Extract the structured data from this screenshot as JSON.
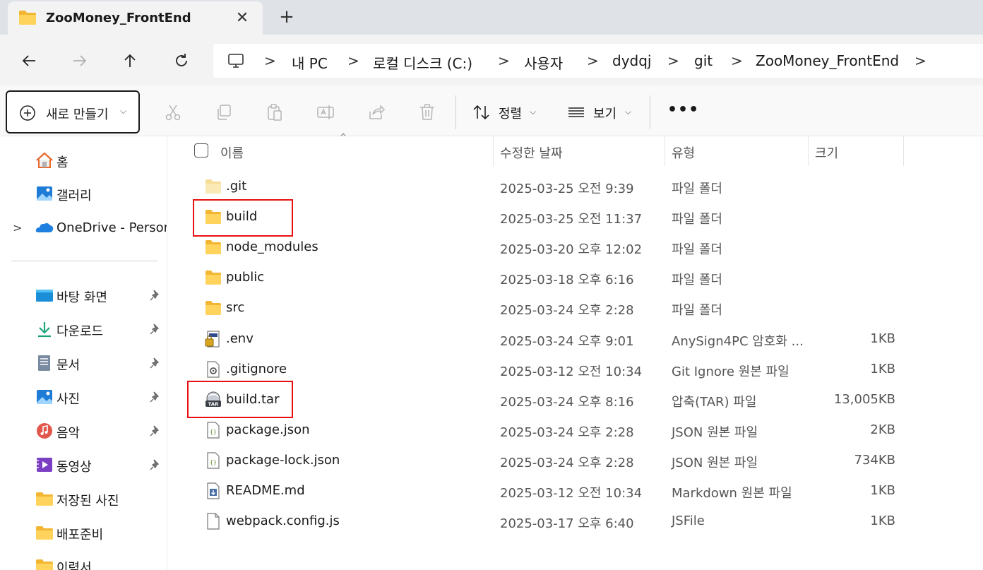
{
  "window": {
    "tab_title": "ZooMoney_FrontEnd",
    "close_glyph": "✕",
    "new_tab_glyph": "+"
  },
  "nav": {
    "back_icon": "arrow-left",
    "forward_icon": "arrow-right",
    "up_icon": "arrow-up",
    "refresh_icon": "refresh",
    "breadcrumbs": [
      "내 PC",
      "로컬 디스크 (C:)",
      "사용자",
      "dydqj",
      "git",
      "ZooMoney_FrontEnd"
    ],
    "separator": ">"
  },
  "toolbar": {
    "new_label": "새로 만들기",
    "sort_label": "정렬",
    "view_label": "보기",
    "more_label": "•••",
    "dropdown_glyph": "⌵"
  },
  "sidebar": {
    "items": [
      {
        "label": "홈",
        "icon": "home-icon"
      },
      {
        "label": "갤러리",
        "icon": "gallery-icon"
      },
      {
        "label": "OneDrive - Persona",
        "icon": "onedrive-icon",
        "expandable": true
      }
    ],
    "pinned": [
      {
        "label": "바탕 화면",
        "icon": "desktop-icon",
        "pinned": true
      },
      {
        "label": "다운로드",
        "icon": "download-icon",
        "pinned": true
      },
      {
        "label": "문서",
        "icon": "document-icon",
        "pinned": true
      },
      {
        "label": "사진",
        "icon": "pictures-icon",
        "pinned": true
      },
      {
        "label": "음악",
        "icon": "music-icon",
        "pinned": true
      },
      {
        "label": "동영상",
        "icon": "video-icon",
        "pinned": true
      },
      {
        "label": "저장된 사진",
        "icon": "folder-icon",
        "pinned": false
      },
      {
        "label": "배포준비",
        "icon": "folder-icon",
        "pinned": false
      },
      {
        "label": "이력서",
        "icon": "folder-icon",
        "pinned": false
      }
    ]
  },
  "list": {
    "columns": [
      "이름",
      "수정한 날짜",
      "유형",
      "크기"
    ],
    "files": [
      {
        "name": ".git",
        "date": "2025-03-25 오전 9:39",
        "type": "파일 폴더",
        "size": "",
        "icon": "folder-icon-light",
        "highlighted": false
      },
      {
        "name": "build",
        "date": "2025-03-25 오전 11:37",
        "type": "파일 폴더",
        "size": "",
        "icon": "folder-icon",
        "highlighted": true
      },
      {
        "name": "node_modules",
        "date": "2025-03-20 오후 12:02",
        "type": "파일 폴더",
        "size": "",
        "icon": "folder-icon",
        "highlighted": false
      },
      {
        "name": "public",
        "date": "2025-03-18 오후 6:16",
        "type": "파일 폴더",
        "size": "",
        "icon": "folder-icon",
        "highlighted": false
      },
      {
        "name": "src",
        "date": "2025-03-24 오후 2:28",
        "type": "파일 폴더",
        "size": "",
        "icon": "folder-icon",
        "highlighted": false
      },
      {
        "name": ".env",
        "date": "2025-03-24 오후 9:01",
        "type": "AnySign4PC 암호화 ...",
        "size": "1KB",
        "icon": "encrypted-file-icon",
        "highlighted": false
      },
      {
        "name": ".gitignore",
        "date": "2025-03-12 오전 10:34",
        "type": "Git Ignore 원본 파일",
        "size": "1KB",
        "icon": "gear-file-icon",
        "highlighted": false
      },
      {
        "name": "build.tar",
        "date": "2025-03-24 오후 8:16",
        "type": "압축(TAR) 파일",
        "size": "13,005KB",
        "icon": "tar-archive-icon",
        "highlighted": true
      },
      {
        "name": "package.json",
        "date": "2025-03-24 오후 2:28",
        "type": "JSON 원본 파일",
        "size": "2KB",
        "icon": "json-file-icon",
        "highlighted": false
      },
      {
        "name": "package-lock.json",
        "date": "2025-03-24 오후 2:28",
        "type": "JSON 원본 파일",
        "size": "734KB",
        "icon": "json-file-icon",
        "highlighted": false
      },
      {
        "name": "README.md",
        "date": "2025-03-12 오전 10:34",
        "type": "Markdown 원본 파일",
        "size": "1KB",
        "icon": "markdown-file-icon",
        "highlighted": false
      },
      {
        "name": "webpack.config.js",
        "date": "2025-03-17 오후 6:40",
        "type": "JSFile",
        "size": "1KB",
        "icon": "blank-file-icon",
        "highlighted": false
      }
    ]
  },
  "colors": {
    "folder": "#f5c343",
    "highlight": "#e81010",
    "accent": "#0067c0"
  }
}
